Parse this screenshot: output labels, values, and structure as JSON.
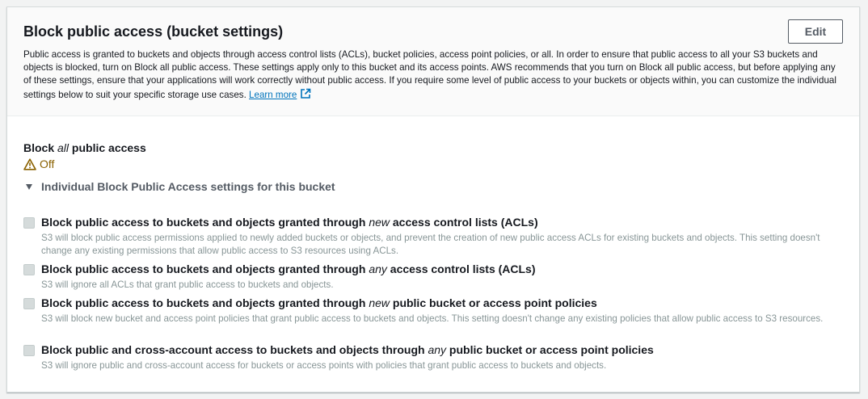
{
  "header": {
    "title": "Block public access (bucket settings)",
    "edit_label": "Edit",
    "description": "Public access is granted to buckets and objects through access control lists (ACLs), bucket policies, access point policies, or all. In order to ensure that public access to all your S3 buckets and objects is blocked, turn on Block all public access. These settings apply only to this bucket and its access points. AWS recommends that you turn on Block all public access, but before applying any of these settings, ensure that your applications will work correctly without public access. If you require some level of public access to your buckets or objects within, you can customize the individual settings below to suit your specific storage use cases.",
    "learn_more": "Learn more"
  },
  "block_all": {
    "label_pre": "Block ",
    "label_em": "all",
    "label_post": " public access",
    "status": "Off",
    "status_icon": "warning-icon",
    "status_color": "#8a6100"
  },
  "individual": {
    "toggle_label": "Individual Block Public Access settings for this bucket",
    "options": [
      {
        "title_pre": "Block public access to buckets and objects granted through ",
        "title_em": "new",
        "title_post": " access control lists (ACLs)",
        "description": "S3 will block public access permissions applied to newly added buckets or objects, and prevent the creation of new public access ACLs for existing buckets and objects. This setting doesn't change any existing permissions that allow public access to S3 resources using ACLs.",
        "checked": false
      },
      {
        "title_pre": "Block public access to buckets and objects granted through ",
        "title_em": "any",
        "title_post": " access control lists (ACLs)",
        "description": "S3 will ignore all ACLs that grant public access to buckets and objects.",
        "checked": false
      },
      {
        "title_pre": "Block public access to buckets and objects granted through ",
        "title_em": "new",
        "title_post": " public bucket or access point policies",
        "description": "S3 will block new bucket and access point policies that grant public access to buckets and objects. This setting doesn't change any existing policies that allow public access to S3 resources.",
        "checked": false
      },
      {
        "title_pre": "Block public and cross-account access to buckets and objects through ",
        "title_em": "any",
        "title_post": " public bucket or access point policies",
        "description": "S3 will ignore public and cross-account access for buckets or access points with policies that grant public access to buckets and objects.",
        "checked": false
      }
    ]
  }
}
